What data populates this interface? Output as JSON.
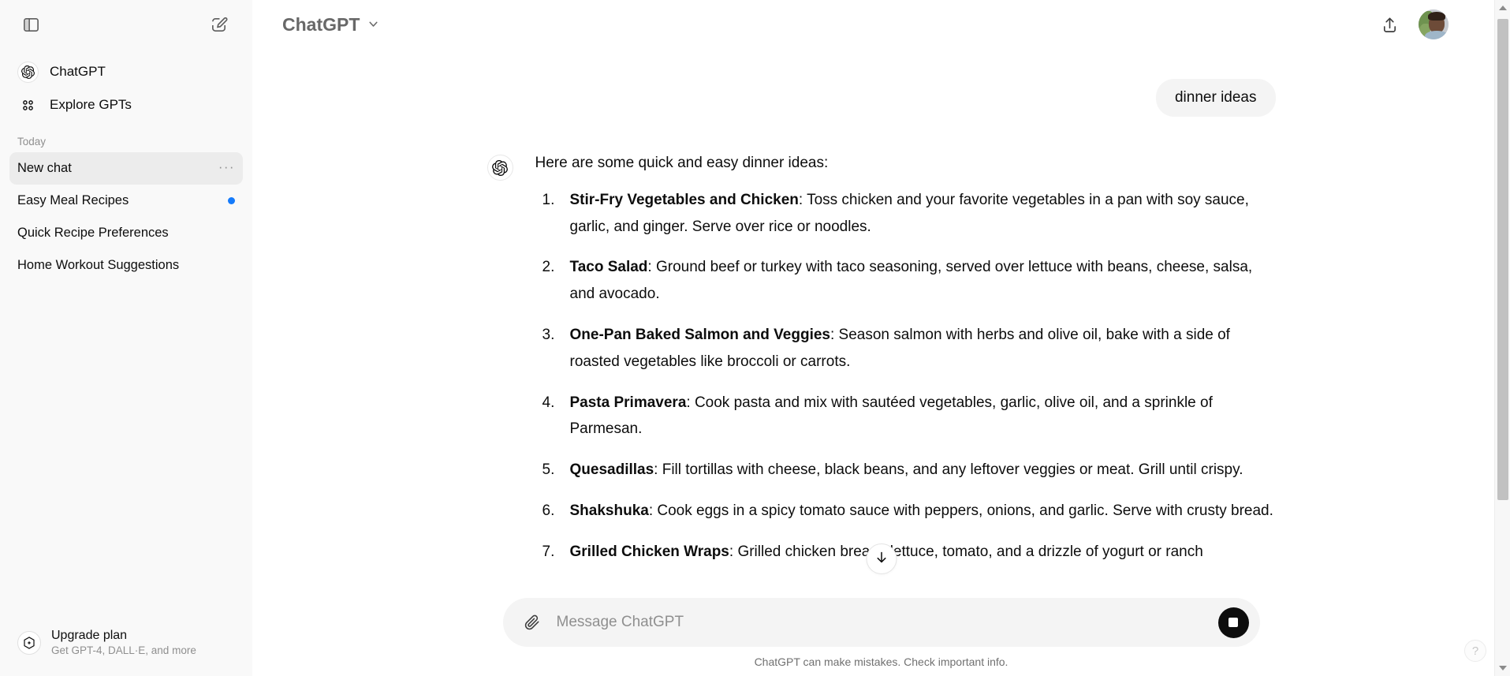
{
  "sidebar": {
    "toggle_icon": "sidebar-toggle-icon",
    "new_chat_icon": "new-chat-pencil-icon",
    "nav": [
      {
        "label": "ChatGPT",
        "icon": "openai-logo-icon"
      },
      {
        "label": "Explore GPTs",
        "icon": "grid-dots-icon"
      }
    ],
    "section_label": "Today",
    "chats": [
      {
        "title": "New chat",
        "active": true,
        "menu": "···",
        "dot": false
      },
      {
        "title": "Easy Meal Recipes",
        "active": false,
        "dot": true
      },
      {
        "title": "Quick Recipe Preferences",
        "active": false,
        "dot": false
      },
      {
        "title": "Home Workout Suggestions",
        "active": false,
        "dot": false
      }
    ],
    "upgrade": {
      "title": "Upgrade plan",
      "subtitle": "Get GPT-4, DALL·E, and more",
      "icon": "upgrade-sparkle-hex-icon"
    }
  },
  "header": {
    "model": "ChatGPT",
    "chevron_icon": "chevron-down-icon",
    "share_icon": "share-upload-icon",
    "avatar": "user-avatar"
  },
  "conversation": {
    "user_message": "dinner ideas",
    "assistant": {
      "avatar_icon": "openai-logo-icon",
      "intro": "Here are some quick and easy dinner ideas:",
      "items": [
        {
          "title": "Stir-Fry Vegetables and Chicken",
          "body": ": Toss chicken and your favorite vegetables in a pan with soy sauce, garlic, and ginger. Serve over rice or noodles."
        },
        {
          "title": "Taco Salad",
          "body": ": Ground beef or turkey with taco seasoning, served over lettuce with beans, cheese, salsa, and avocado."
        },
        {
          "title": "One-Pan Baked Salmon and Veggies",
          "body": ": Season salmon with herbs and olive oil, bake with a side of roasted vegetables like broccoli or carrots."
        },
        {
          "title": "Pasta Primavera",
          "body": ": Cook pasta and mix with sautéed vegetables, garlic, olive oil, and a sprinkle of Parmesan."
        },
        {
          "title": "Quesadillas",
          "body": ": Fill tortillas with cheese, black beans, and any leftover veggies or meat. Grill until crispy."
        },
        {
          "title": "Shakshuka",
          "body": ": Cook eggs in a spicy tomato sauce with peppers, onions, and garlic. Serve with crusty bread."
        },
        {
          "title": "Grilled Chicken Wraps",
          "body": ": Grilled chicken breast, lettuce, tomato, and a drizzle of yogurt or ranch"
        }
      ]
    },
    "scroll_button_icon": "arrow-down-icon"
  },
  "composer": {
    "attach_icon": "paperclip-icon",
    "placeholder": "Message ChatGPT",
    "value": "",
    "stop_button_icon": "stop-square-icon",
    "disclaimer": "ChatGPT can make mistakes. Check important info."
  },
  "help": {
    "label": "?"
  },
  "colors": {
    "sidebar_bg": "#f9f9f9",
    "active_item": "#ececec",
    "accent_dot": "#157bfb",
    "bubble_bg": "#f4f4f4",
    "text": "#0d0d0d",
    "muted": "#8f8f8f"
  }
}
